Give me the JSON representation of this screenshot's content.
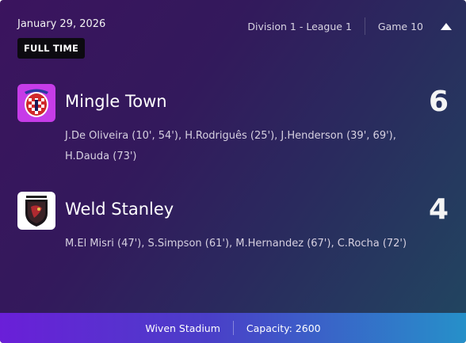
{
  "match": {
    "date": "January 29, 2026",
    "status": "FULL TIME",
    "competition": "Division 1 - League 1",
    "game": "Game 10"
  },
  "home": {
    "name": "Mingle Town",
    "score": "6",
    "scorers": "J.De Oliveira (10', 54'), H.Rodriguês (25'), J.Henderson (39', 69'), H.Dauda (73')"
  },
  "away": {
    "name": "Weld Stanley",
    "score": "4",
    "scorers": "M.El Misri (47'), S.Simpson (61'), M.Hernandez (67'), C.Rocha (72')"
  },
  "venue": {
    "stadium": "Wiven Stadium",
    "capacity": "Capacity: 2600"
  },
  "icons": {
    "collapse": "chevron-up-icon",
    "home_crest": "checkered-shield-crest",
    "away_crest": "dark-shield-crest"
  },
  "colors": {
    "home_crest_bg": "#c63ce8",
    "away_crest_bg": "#ffffff",
    "footer_start": "#6a1fd8",
    "footer_end": "#2690c9"
  }
}
